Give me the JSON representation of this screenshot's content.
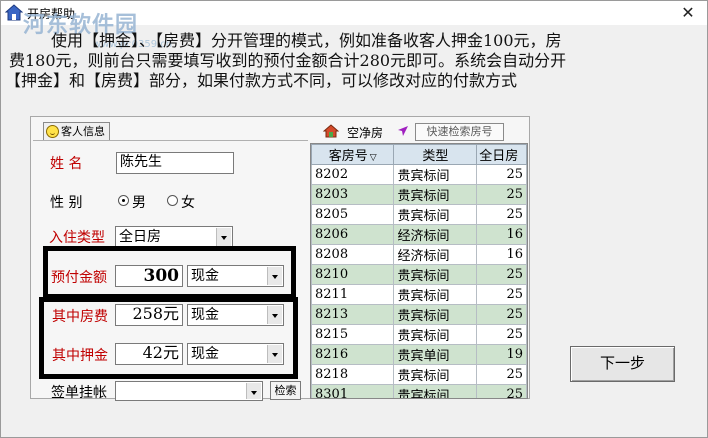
{
  "window": {
    "title": "开房帮助",
    "close_label": "✕",
    "watermark": "河东软件园",
    "watermark_url": "www.pc0359.cn"
  },
  "intro": {
    "line1": "使用【押金】、【房费】分开管理的模式，例如准备收客人押金100元，房",
    "line2": "费180元，则前台只需要填写收到的预付金额合计280元即可。系统会自动分开",
    "line3": "【押金】和【房费】部分，如果付款方式不同，可以修改对应的付款方式"
  },
  "guest_tab": {
    "label": "客人信息"
  },
  "form": {
    "name_label": "姓    名",
    "name_value": "陈先生",
    "gender_label": "性    别",
    "gender_male": "男",
    "gender_female": "女",
    "checkin_type_label": "入住类型",
    "checkin_type_value": "全日房",
    "prepay_label": "预付金额",
    "prepay_value": "300",
    "prepay_method": "现金",
    "room_fee_label": "其中房费",
    "room_fee_value": "258元",
    "room_fee_method": "现金",
    "deposit_label": "其中押金",
    "deposit_value": "42元",
    "deposit_method": "现金",
    "sign_label": "签单挂帐",
    "sign_value": "",
    "search_label": "检索"
  },
  "room_panel": {
    "status_label": "空净房",
    "quick_search_label": "快速检索房号",
    "columns": [
      "客房号",
      "类型",
      "全日房"
    ],
    "rows": [
      {
        "room": "8202",
        "type": "贵宾标间",
        "price": "25",
        "highlight": false
      },
      {
        "room": "8203",
        "type": "贵宾标间",
        "price": "25",
        "highlight": true
      },
      {
        "room": "8205",
        "type": "贵宾标间",
        "price": "25",
        "highlight": false
      },
      {
        "room": "8206",
        "type": "经济标间",
        "price": "16",
        "highlight": true
      },
      {
        "room": "8208",
        "type": "经济标间",
        "price": "16",
        "highlight": false
      },
      {
        "room": "8210",
        "type": "贵宾标间",
        "price": "25",
        "highlight": true
      },
      {
        "room": "8211",
        "type": "贵宾标间",
        "price": "25",
        "highlight": false
      },
      {
        "room": "8213",
        "type": "贵宾标间",
        "price": "25",
        "highlight": true
      },
      {
        "room": "8215",
        "type": "贵宾标间",
        "price": "25",
        "highlight": false
      },
      {
        "room": "8216",
        "type": "贵宾单间",
        "price": "19",
        "highlight": true
      },
      {
        "room": "8218",
        "type": "贵宾标间",
        "price": "25",
        "highlight": false
      },
      {
        "room": "8301",
        "type": "贵宾标间",
        "price": "25",
        "highlight": true
      }
    ]
  },
  "next_button": {
    "label": "下一步"
  }
}
